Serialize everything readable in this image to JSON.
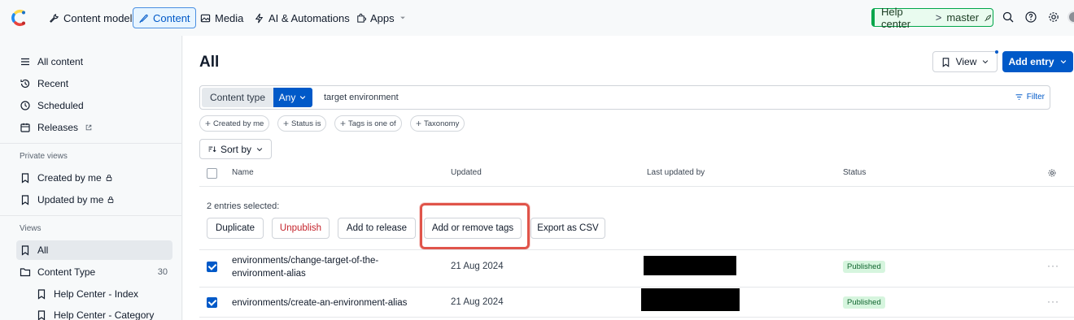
{
  "topnav": {
    "content_model": "Content model",
    "content": "Content",
    "media": "Media",
    "ai_automations": "AI & Automations",
    "apps": "Apps",
    "environment": {
      "space": "Help center",
      "separator": ">",
      "env": "master"
    }
  },
  "sidebar": {
    "items": [
      {
        "label": "All content",
        "icon": "list-icon"
      },
      {
        "label": "Recent",
        "icon": "history-icon"
      },
      {
        "label": "Scheduled",
        "icon": "clock-icon"
      },
      {
        "label": "Releases",
        "icon": "calendar-icon"
      }
    ],
    "private_views_heading": "Private views",
    "private_views": [
      {
        "label": "Created by me"
      },
      {
        "label": "Updated by me"
      }
    ],
    "views_heading": "Views",
    "views": [
      {
        "label": "All"
      },
      {
        "label": "Content Type",
        "count": "30"
      },
      {
        "label": "Help Center - Index"
      },
      {
        "label": "Help Center - Category"
      }
    ]
  },
  "main": {
    "title": "All",
    "view_button": "View",
    "add_entry_button": "Add entry",
    "search": {
      "content_type_label": "Content type",
      "content_type_value": "Any",
      "query": "target environment",
      "filter_label": "Filter"
    },
    "chips": [
      "Created by me",
      "Status is",
      "Tags is one of",
      "Taxonomy"
    ],
    "sort_label": "Sort by",
    "columns": {
      "name": "Name",
      "updated": "Updated",
      "last_updated_by": "Last updated by",
      "status": "Status"
    },
    "selection_text": "2 entries selected:",
    "actions": {
      "duplicate": "Duplicate",
      "unpublish": "Unpublish",
      "add_to_release": "Add to release",
      "add_remove_tags": "Add or remove tags",
      "export_csv": "Export as CSV"
    },
    "rows": [
      {
        "name_line1": "environments/change-target-of-the-",
        "name_line2": "environment-alias",
        "updated": "21 Aug 2024",
        "status": "Published",
        "more": "···"
      },
      {
        "name_line1": "environments/create-an-environment-alias",
        "updated": "21 Aug 2024",
        "status": "Published",
        "more": "···"
      }
    ]
  }
}
